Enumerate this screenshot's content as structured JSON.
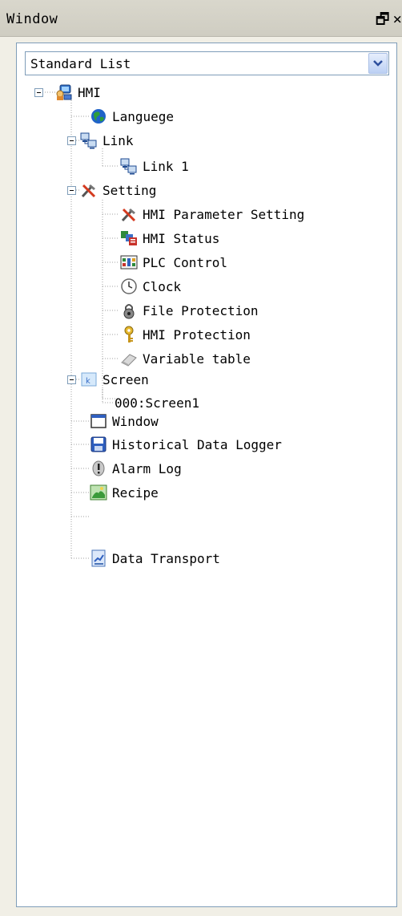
{
  "window": {
    "title": "Window",
    "restore_icon": "restore-icon",
    "close_icon": "close-icon"
  },
  "dropdown": {
    "selected": "Standard List",
    "arrow_icon": "chevron-down-icon"
  },
  "tree": {
    "root": {
      "label": "HMI",
      "icon": "hmi-icon"
    },
    "items": [
      {
        "label": "Languege",
        "icon": "globe-icon"
      },
      {
        "label": "Link",
        "icon": "network-icon"
      },
      {
        "label": "Link 1",
        "icon": "network-icon"
      },
      {
        "label": "Setting",
        "icon": "tools-icon"
      },
      {
        "label": "HMI Parameter Setting",
        "icon": "tools-icon"
      },
      {
        "label": "HMI Status",
        "icon": "status-icon"
      },
      {
        "label": "PLC Control",
        "icon": "plc-icon"
      },
      {
        "label": "Clock",
        "icon": "clock-icon"
      },
      {
        "label": "File Protection",
        "icon": "lock-icon"
      },
      {
        "label": "HMI Protection",
        "icon": "key-icon"
      },
      {
        "label": "Variable table",
        "icon": "eraser-icon"
      },
      {
        "label": "Screen",
        "icon": "screen-icon"
      },
      {
        "label": "000:Screen1",
        "icon": ""
      },
      {
        "label": "Window",
        "icon": "window-icon"
      },
      {
        "label": "Historical Data Logger",
        "icon": "floppy-icon"
      },
      {
        "label": "Alarm Log",
        "icon": "alarm-icon"
      },
      {
        "label": "Recipe",
        "icon": "recipe-icon"
      },
      {
        "label": "Data Transport",
        "icon": "transport-icon"
      }
    ]
  }
}
